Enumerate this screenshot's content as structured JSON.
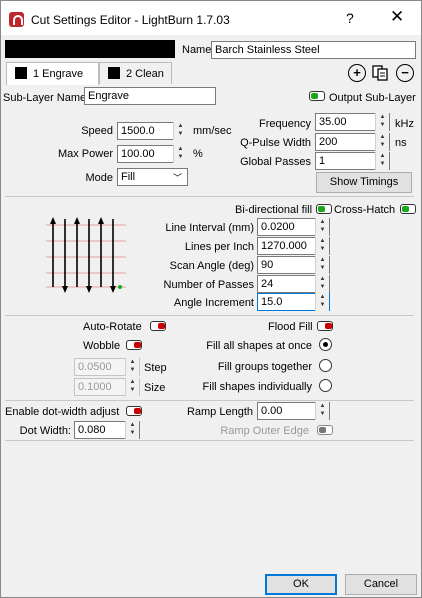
{
  "window": {
    "title": "Cut Settings Editor - LightBurn 1.7.03",
    "help_glyph": "?",
    "close_glyph": "✕"
  },
  "colors": {
    "layer_color": "#000000",
    "accent": "#0078d7",
    "toggle_on": "#1aa81a",
    "toggle_off": "#cc0000"
  },
  "name": {
    "label": "Name",
    "value": "Barch Stainless Steel"
  },
  "tabs": [
    {
      "label": "1 Engrave",
      "active": true
    },
    {
      "label": "2 Clean",
      "active": false
    }
  ],
  "tab_actions": {
    "add_icon": "plus-circle-icon",
    "copy_icon": "copy-icon",
    "remove_icon": "minus-circle-icon"
  },
  "sublayer": {
    "label": "Sub-Layer Name",
    "value": "Engrave",
    "output_label": "Output Sub-Layer"
  },
  "speed": {
    "label": "Speed",
    "value": "1500.0",
    "unit": "mm/sec"
  },
  "max_power": {
    "label": "Max Power",
    "value": "100.00",
    "unit": "%"
  },
  "mode": {
    "label": "Mode",
    "value": "Fill"
  },
  "frequency": {
    "label": "Frequency",
    "value": "35.00",
    "unit": "kHz"
  },
  "qpulse": {
    "label": "Q-Pulse Width",
    "value": "200",
    "unit": "ns"
  },
  "global_passes": {
    "label": "Global Passes",
    "value": "1"
  },
  "show_timings": "Show Timings",
  "bidir_label": "Bi-directional fill",
  "crosshatch_label": "Cross-Hatch",
  "line_interval": {
    "label": "Line Interval (mm)",
    "value": "0.0200"
  },
  "lines_per_inch": {
    "label": "Lines per Inch",
    "value": "1270.000"
  },
  "scan_angle": {
    "label": "Scan Angle (deg)",
    "value": "90"
  },
  "num_passes": {
    "label": "Number of Passes",
    "value": "24"
  },
  "angle_increment": {
    "label": "Angle Increment",
    "value": "15.0"
  },
  "auto_rotate_label": "Auto-Rotate",
  "flood_fill_label": "Flood Fill",
  "wobble": {
    "label": "Wobble",
    "step_value": "0.0500",
    "step_label": "Step",
    "size_value": "0.1000",
    "size_label": "Size"
  },
  "fill_options": [
    {
      "label": "Fill all shapes at once",
      "selected": true
    },
    {
      "label": "Fill groups together",
      "selected": false
    },
    {
      "label": "Fill shapes individually",
      "selected": false
    }
  ],
  "dot_width_adjust_label": "Enable dot-width adjust",
  "dot_width": {
    "label": "Dot Width:",
    "value": "0.080"
  },
  "ramp_length": {
    "label": "Ramp Length",
    "value": "0.00"
  },
  "ramp_outer_edge_label": "Ramp Outer Edge",
  "footer": {
    "ok": "OK",
    "cancel": "Cancel"
  }
}
